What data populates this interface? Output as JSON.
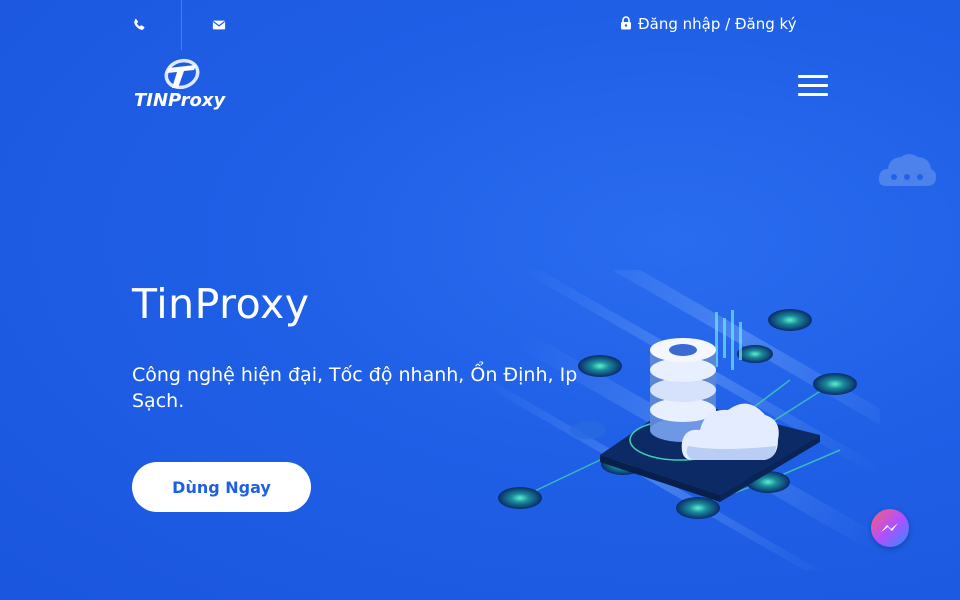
{
  "topbar": {
    "phone_icon": "phone-icon",
    "mail_icon": "mail-icon",
    "lock_icon": "lock-icon",
    "login_label": "Đăng nhập",
    "separator": " / ",
    "register_label": "Đăng ký"
  },
  "brand": {
    "logo_text": "TINProxy",
    "logo_colors": {
      "primary": "#ffffff"
    }
  },
  "nav": {
    "menu_icon": "hamburger-menu-icon"
  },
  "hero": {
    "title": "TinProxy",
    "subtitle": "Công nghệ hiện đại, Tốc độ nhanh, Ổn Định, Ip Sạch.",
    "cta_label": "Dùng Ngay"
  },
  "widgets": {
    "chat_icon": "messenger-icon"
  },
  "colors": {
    "background": "#1f5fe6",
    "button_text": "#1f5fe6",
    "button_bg": "#ffffff"
  }
}
